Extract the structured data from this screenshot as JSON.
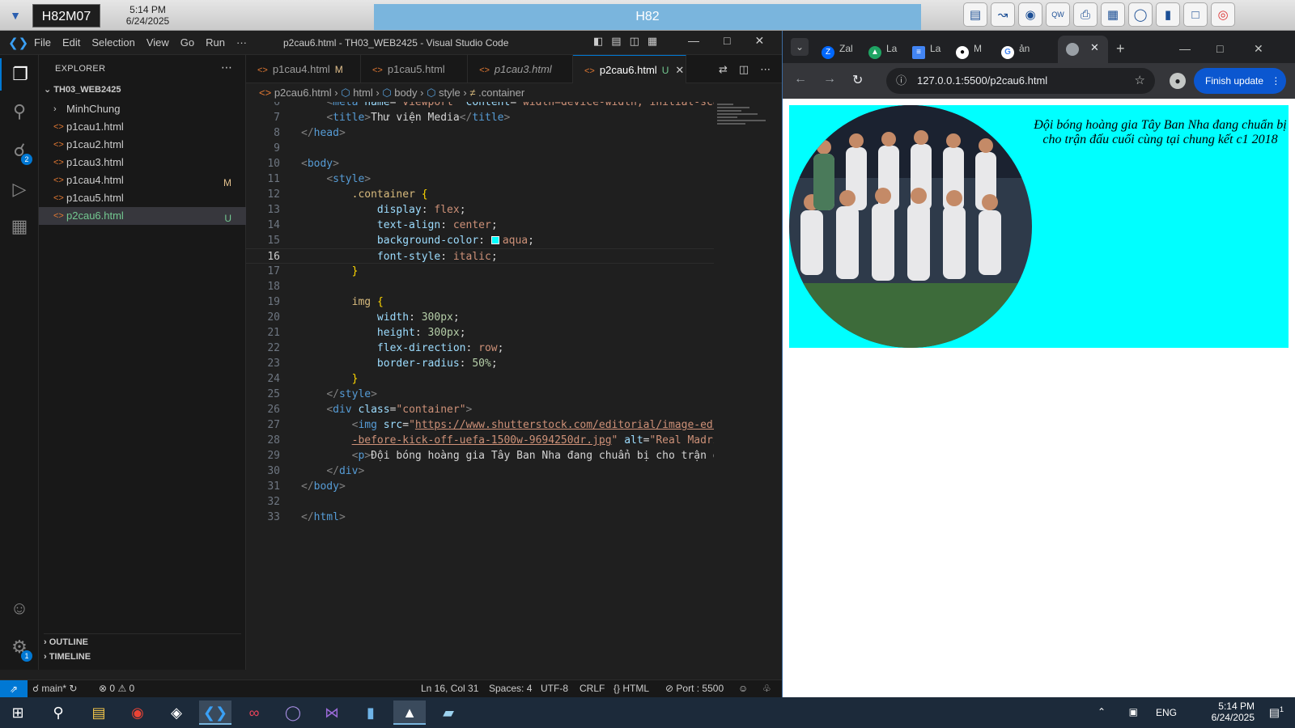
{
  "topbar": {
    "machine": "H82M07",
    "time": "5:14 PM",
    "date": "6/24/2025",
    "center_title": "H82",
    "icons": [
      "server-icon",
      "chart-icon",
      "disc-icon",
      "keyboard-icon",
      "printer-icon",
      "window-icon",
      "globe-icon",
      "book-icon",
      "chat-icon",
      "lifebuoy-icon"
    ]
  },
  "vscode": {
    "menus": [
      "File",
      "Edit",
      "Selection",
      "View",
      "Go",
      "Run",
      "···"
    ],
    "window_title": "p2cau6.html - TH03_WEB2425 - Visual Studio Code",
    "explorer": {
      "header": "EXPLORER",
      "folder": "TH03_WEB2425",
      "items": [
        {
          "name": "MinhChung",
          "status": ""
        },
        {
          "name": "p1cau1.html",
          "status": ""
        },
        {
          "name": "p1cau2.html",
          "status": ""
        },
        {
          "name": "p1cau3.html",
          "status": ""
        },
        {
          "name": "p1cau4.html",
          "status": "M"
        },
        {
          "name": "p1cau5.html",
          "status": ""
        },
        {
          "name": "p2cau6.html",
          "status": "U"
        }
      ],
      "outline": "OUTLINE",
      "timeline": "TIMELINE",
      "scm_badge": "2",
      "settings_badge": "1"
    },
    "tabs": [
      {
        "label": "p1cau4.html",
        "status": "M"
      },
      {
        "label": "p1cau5.html",
        "status": ""
      },
      {
        "label": "p1cau3.html",
        "status": ""
      },
      {
        "label": "p2cau6.html",
        "status": "U"
      }
    ],
    "breadcrumb": [
      "p2cau6.html",
      "html",
      "body",
      "style",
      ".container"
    ],
    "code_lines": [
      {
        "n": "6"
      },
      {
        "n": "7"
      },
      {
        "n": "8"
      },
      {
        "n": "9"
      },
      {
        "n": "10"
      },
      {
        "n": "11"
      },
      {
        "n": "12"
      },
      {
        "n": "13"
      },
      {
        "n": "14"
      },
      {
        "n": "15"
      },
      {
        "n": "16"
      },
      {
        "n": "17"
      },
      {
        "n": "18"
      },
      {
        "n": "19"
      },
      {
        "n": "20"
      },
      {
        "n": "21"
      },
      {
        "n": "22"
      },
      {
        "n": "23"
      },
      {
        "n": "24"
      },
      {
        "n": "25"
      },
      {
        "n": "26"
      },
      {
        "n": "27"
      },
      {
        "n": "28"
      },
      {
        "n": "29"
      },
      {
        "n": "30"
      },
      {
        "n": "31"
      },
      {
        "n": "32"
      },
      {
        "n": "33"
      }
    ],
    "code": {
      "l6_attr1": "name",
      "l6_val1": "\"viewport\"",
      "l6_attr2": "content",
      "l6_val2": "\"width=device-width, initial-sca",
      "l7_title": "Thư viện Media",
      "l15_color": "aqua",
      "l27_src": "https://www.shutterstock.com/editorial/image-edi",
      "l28_src": "-before-kick-off-uefa-1500w-9694250dr.jpg",
      "l28_alt": "\"Real Madri",
      "l29_text": "Đội bóng hoàng gia Tây Ban Nha đang chuẩn bị cho trận đ"
    },
    "status": {
      "branch": "main*",
      "errors": "0",
      "warnings": "0",
      "position": "Ln 16, Col 31",
      "spaces": "Spaces: 4",
      "encoding": "UTF-8",
      "eol": "CRLF",
      "language": "HTML",
      "port": "Port : 5500"
    }
  },
  "chrome": {
    "tabs": [
      {
        "label": "Zal",
        "icon": "zalo-icon"
      },
      {
        "label": "La",
        "icon": "drive-icon"
      },
      {
        "label": "La",
        "icon": "docs-icon"
      },
      {
        "label": "M",
        "icon": "github-icon"
      },
      {
        "label": "ản",
        "icon": "google-icon"
      }
    ],
    "url": "127.0.0.1:5500/p2cau6.html",
    "update_button": "Finish update",
    "page": {
      "caption": "Đội bóng hoàng gia Tây Ban Nha đang chuẩn bị cho trận đấu cuối cùng tại chung kết c1 2018",
      "background": "#00ffff"
    }
  },
  "taskbar": {
    "apps": [
      "windows-start-icon",
      "search-icon",
      "file-explorer-icon",
      "chrome-icon",
      "app-icon",
      "vscode-icon",
      "app-icon-2",
      "eclipse-icon",
      "visual-studio-icon",
      "app-icon-3",
      "app-icon-4",
      "app-icon-5"
    ],
    "language": "ENG",
    "time": "5:14 PM",
    "date": "6/24/2025",
    "notifications": "1"
  }
}
